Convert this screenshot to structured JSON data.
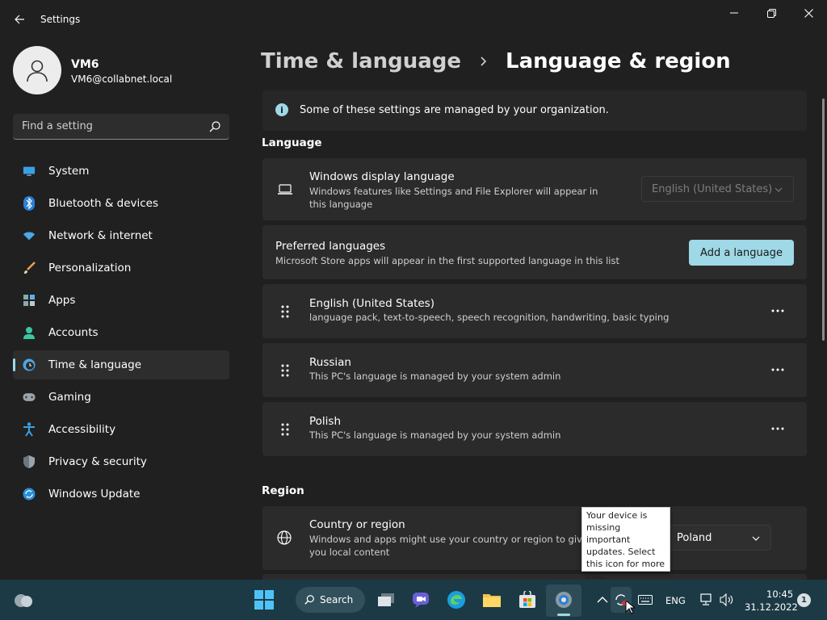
{
  "window": {
    "title": "Settings"
  },
  "profile": {
    "name": "VM6",
    "email": "VM6@collabnet.local"
  },
  "search": {
    "placeholder": "Find a setting"
  },
  "nav": {
    "items": [
      {
        "label": "System",
        "icon": "system-icon"
      },
      {
        "label": "Bluetooth & devices",
        "icon": "bluetooth-icon"
      },
      {
        "label": "Network & internet",
        "icon": "wifi-icon"
      },
      {
        "label": "Personalization",
        "icon": "brush-icon"
      },
      {
        "label": "Apps",
        "icon": "apps-icon"
      },
      {
        "label": "Accounts",
        "icon": "accounts-icon"
      },
      {
        "label": "Time & language",
        "icon": "time-language-icon",
        "active": true
      },
      {
        "label": "Gaming",
        "icon": "gamepad-icon"
      },
      {
        "label": "Accessibility",
        "icon": "accessibility-icon"
      },
      {
        "label": "Privacy & security",
        "icon": "shield-icon"
      },
      {
        "label": "Windows Update",
        "icon": "update-icon"
      }
    ]
  },
  "breadcrumb": {
    "parent": "Time & language",
    "current": "Language & region"
  },
  "info_bar": {
    "text": "Some of these settings are managed by your organization."
  },
  "language_section": {
    "title": "Language",
    "display_language": {
      "title": "Windows display language",
      "subtitle": "Windows features like Settings and File Explorer will appear in this language",
      "value": "English (United States)"
    },
    "preferred": {
      "title": "Preferred languages",
      "subtitle": "Microsoft Store apps will appear in the first supported language in this list",
      "add_button": "Add a language"
    },
    "languages": [
      {
        "name": "English (United States)",
        "detail": "language pack, text-to-speech, speech recognition, handwriting, basic typing"
      },
      {
        "name": "Russian",
        "detail": "This PC's language is managed by your system admin"
      },
      {
        "name": "Polish",
        "detail": "This PC's language is managed by your system admin"
      }
    ]
  },
  "region_section": {
    "title": "Region",
    "country": {
      "title": "Country or region",
      "subtitle": "Windows and apps might use your country or region to give you local content",
      "value": "Poland"
    }
  },
  "tooltip": {
    "text": "Your device is missing important updates. Select this icon for more info."
  },
  "taskbar": {
    "search_label": "Search",
    "language": "ENG",
    "time": "10:45",
    "date": "31.12.2022",
    "notification_count": "1"
  },
  "colors": {
    "accent": "#9fd8e6",
    "background": "#202020",
    "card": "#2b2b2b",
    "taskbar": "#1c3a45"
  }
}
